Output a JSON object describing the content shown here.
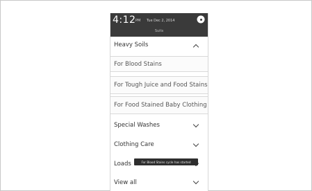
{
  "status": {
    "time": "4:12",
    "ampm": "PM",
    "date": "Tue Dec 2, 2014",
    "subtitle": "Suits"
  },
  "menu": {
    "heavy_soils": "Heavy Soils",
    "for_blood_stains": "For Blood Stains",
    "for_tough_juice": "For Tough Juice and Food Stains",
    "for_food_stained": "For Food Stained Baby Clothing",
    "special_washes": "Special Washes",
    "clothing_care": "Clothing Care",
    "loads": "Loads",
    "view_all": "View all"
  },
  "toast": {
    "text": "For Blood Stains cycle has started"
  }
}
